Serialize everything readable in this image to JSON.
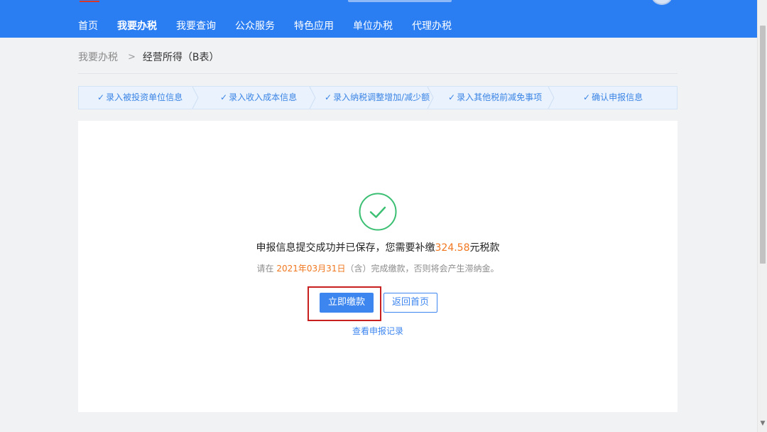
{
  "header": {
    "nav": [
      {
        "label": "首页",
        "active": false
      },
      {
        "label": "我要办税",
        "active": true
      },
      {
        "label": "我要查询",
        "active": false
      },
      {
        "label": "公众服务",
        "active": false
      },
      {
        "label": "特色应用",
        "active": false
      },
      {
        "label": "单位办税",
        "active": false
      },
      {
        "label": "代理办税",
        "active": false
      }
    ]
  },
  "breadcrumb": {
    "parent": "我要办税",
    "separator": ">",
    "current": "经营所得（B表）"
  },
  "steps": [
    {
      "label": "录入被投资单位信息",
      "done": true
    },
    {
      "label": "录入收入成本信息",
      "done": true
    },
    {
      "label": "录入纳税调整增加/减少额",
      "done": true
    },
    {
      "label": "录入其他税前减免事项",
      "done": true
    },
    {
      "label": "确认申报信息",
      "done": true
    }
  ],
  "result": {
    "icon": "check-circle-icon",
    "message_prefix": "申报信息提交成功并已保存，您需要补缴",
    "amount": "324.58",
    "message_suffix": "元税款",
    "sub_prefix": "请在 ",
    "deadline": "2021年03月31日",
    "sub_suffix": "（含）完成缴款，否则将会产生滞纳金。",
    "pay_button": "立即缴款",
    "home_button": "返回首页",
    "records_link": "查看申报记录"
  },
  "colors": {
    "header_bg": "#2b7ef2",
    "success_green": "#3bbf72",
    "accent_orange": "#f0771f",
    "primary_blue": "#3d86f0",
    "highlight_red": "#c8201e"
  }
}
